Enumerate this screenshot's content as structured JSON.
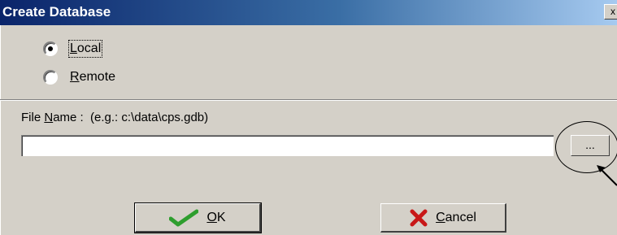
{
  "window": {
    "title": "Create Database",
    "close_glyph": "x"
  },
  "server_type": {
    "options": [
      {
        "label": "Local",
        "mnemonic": "L",
        "rest": "ocal",
        "selected": true
      },
      {
        "label": "Remote",
        "mnemonic": "R",
        "rest": "emote",
        "selected": false
      }
    ]
  },
  "file_name": {
    "label_prefix": "File ",
    "label_mnemonic": "N",
    "label_rest": "ame :",
    "hint": "(e.g.: c:\\data\\cps.gdb)",
    "value": "",
    "browse_label": "..."
  },
  "buttons": {
    "ok": {
      "label": "OK",
      "mnemonic": "O",
      "rest": "K",
      "icon": "checkmark-icon",
      "color": "#2e9e2e"
    },
    "cancel": {
      "label": "Cancel",
      "mnemonic": "C",
      "rest": "ancel",
      "icon": "x-icon",
      "color": "#c81818"
    }
  }
}
